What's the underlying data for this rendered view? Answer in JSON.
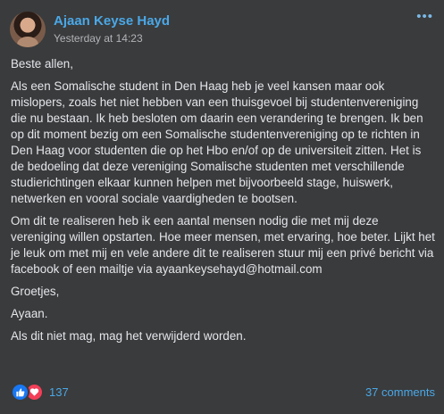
{
  "post": {
    "author": "Ajaan Keyse Hayd",
    "timestamp": "Yesterday at 14:23",
    "more_label": "•••",
    "paragraphs": [
      "Beste allen,",
      "Als een Somalische student in Den Haag heb je veel kansen maar ook mislopers, zoals het niet hebben van een thuisgevoel bij studentenvereniging die nu bestaan. Ik heb besloten om daarin een verandering te brengen. Ik ben op dit moment bezig om een Somalische studentenvereniging op te richten in Den Haag voor studenten die op het Hbo en/of op de universiteit zitten. Het is de bedoeling dat deze vereniging Somalische studenten met verschillende studierichtingen elkaar kunnen helpen met bijvoorbeeld stage, huiswerk, netwerken en vooral sociale vaardigheden te bootsen.",
      "Om dit te realiseren heb ik een aantal mensen nodig die met mij deze vereniging willen opstarten. Hoe meer mensen, met ervaring, hoe beter. Lijkt het je leuk om met mij en vele andere dit te realiseren stuur mij een privé bericht via facebook of een mailtje via ayaankeysehayd@hotmail.com",
      "Groetjes,",
      "Ayaan.",
      "Als dit niet mag, mag het verwijderd worden."
    ]
  },
  "footer": {
    "reaction_count": "137",
    "comments_label": "37 comments",
    "icons": [
      "like-icon",
      "love-icon"
    ]
  },
  "colors": {
    "background": "#3a3b3c",
    "author_link": "#4aa8e8",
    "text": "#e4e6eb",
    "muted": "#b0b3b8",
    "like": "#1877f2",
    "love": "#f33e58"
  }
}
